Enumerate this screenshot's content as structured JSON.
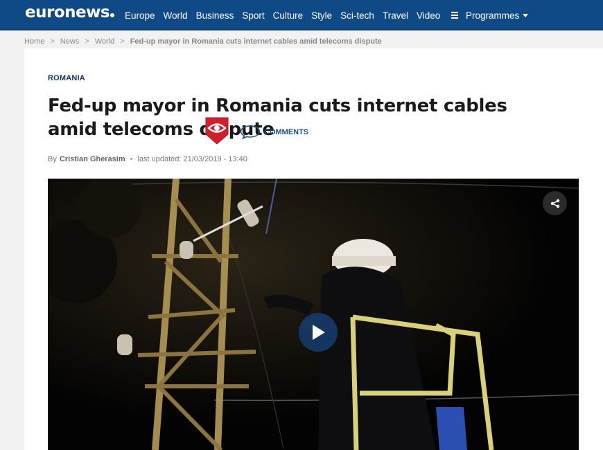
{
  "brand": {
    "logo_text": "euronews"
  },
  "nav": {
    "items": [
      "Europe",
      "World",
      "Business",
      "Sport",
      "Culture",
      "Style",
      "Sci-tech",
      "Travel",
      "Video"
    ],
    "programmes_label": "Programmes"
  },
  "breadcrumb": {
    "items": [
      "Home",
      "News",
      "World"
    ],
    "current": "Fed-up mayor in Romania cuts internet cables amid telecoms dispute"
  },
  "article": {
    "kicker": "ROMANIA",
    "headline": "Fed-up mayor in Romania cuts internet cables amid telecoms dispute",
    "comments_label": "COMMENTS",
    "byline_prefix": "By",
    "author": "Cristian Gherasim",
    "updated": "last updated: 21/03/2019 - 13:40"
  },
  "colors": {
    "nav_bg": "#0f4a86",
    "badge_red": "#d0202e",
    "accent_blue": "#1b4f8a"
  }
}
